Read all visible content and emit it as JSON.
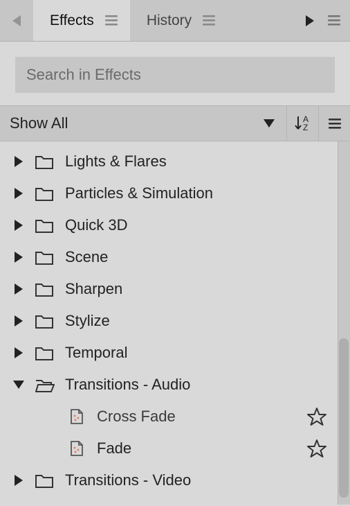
{
  "tabs": {
    "effects": "Effects",
    "history": "History"
  },
  "search": {
    "placeholder": "Search in Effects"
  },
  "filter": {
    "label": "Show All"
  },
  "tree": [
    {
      "label": "Lights & Flares"
    },
    {
      "label": "Particles & Simulation"
    },
    {
      "label": "Quick 3D"
    },
    {
      "label": "Scene"
    },
    {
      "label": "Sharpen"
    },
    {
      "label": "Stylize"
    },
    {
      "label": "Temporal"
    },
    {
      "label": "Transitions - Audio",
      "expanded": true,
      "children": [
        {
          "label": "Cross Fade",
          "selected": true
        },
        {
          "label": "Fade"
        }
      ]
    },
    {
      "label": "Transitions - Video"
    }
  ]
}
